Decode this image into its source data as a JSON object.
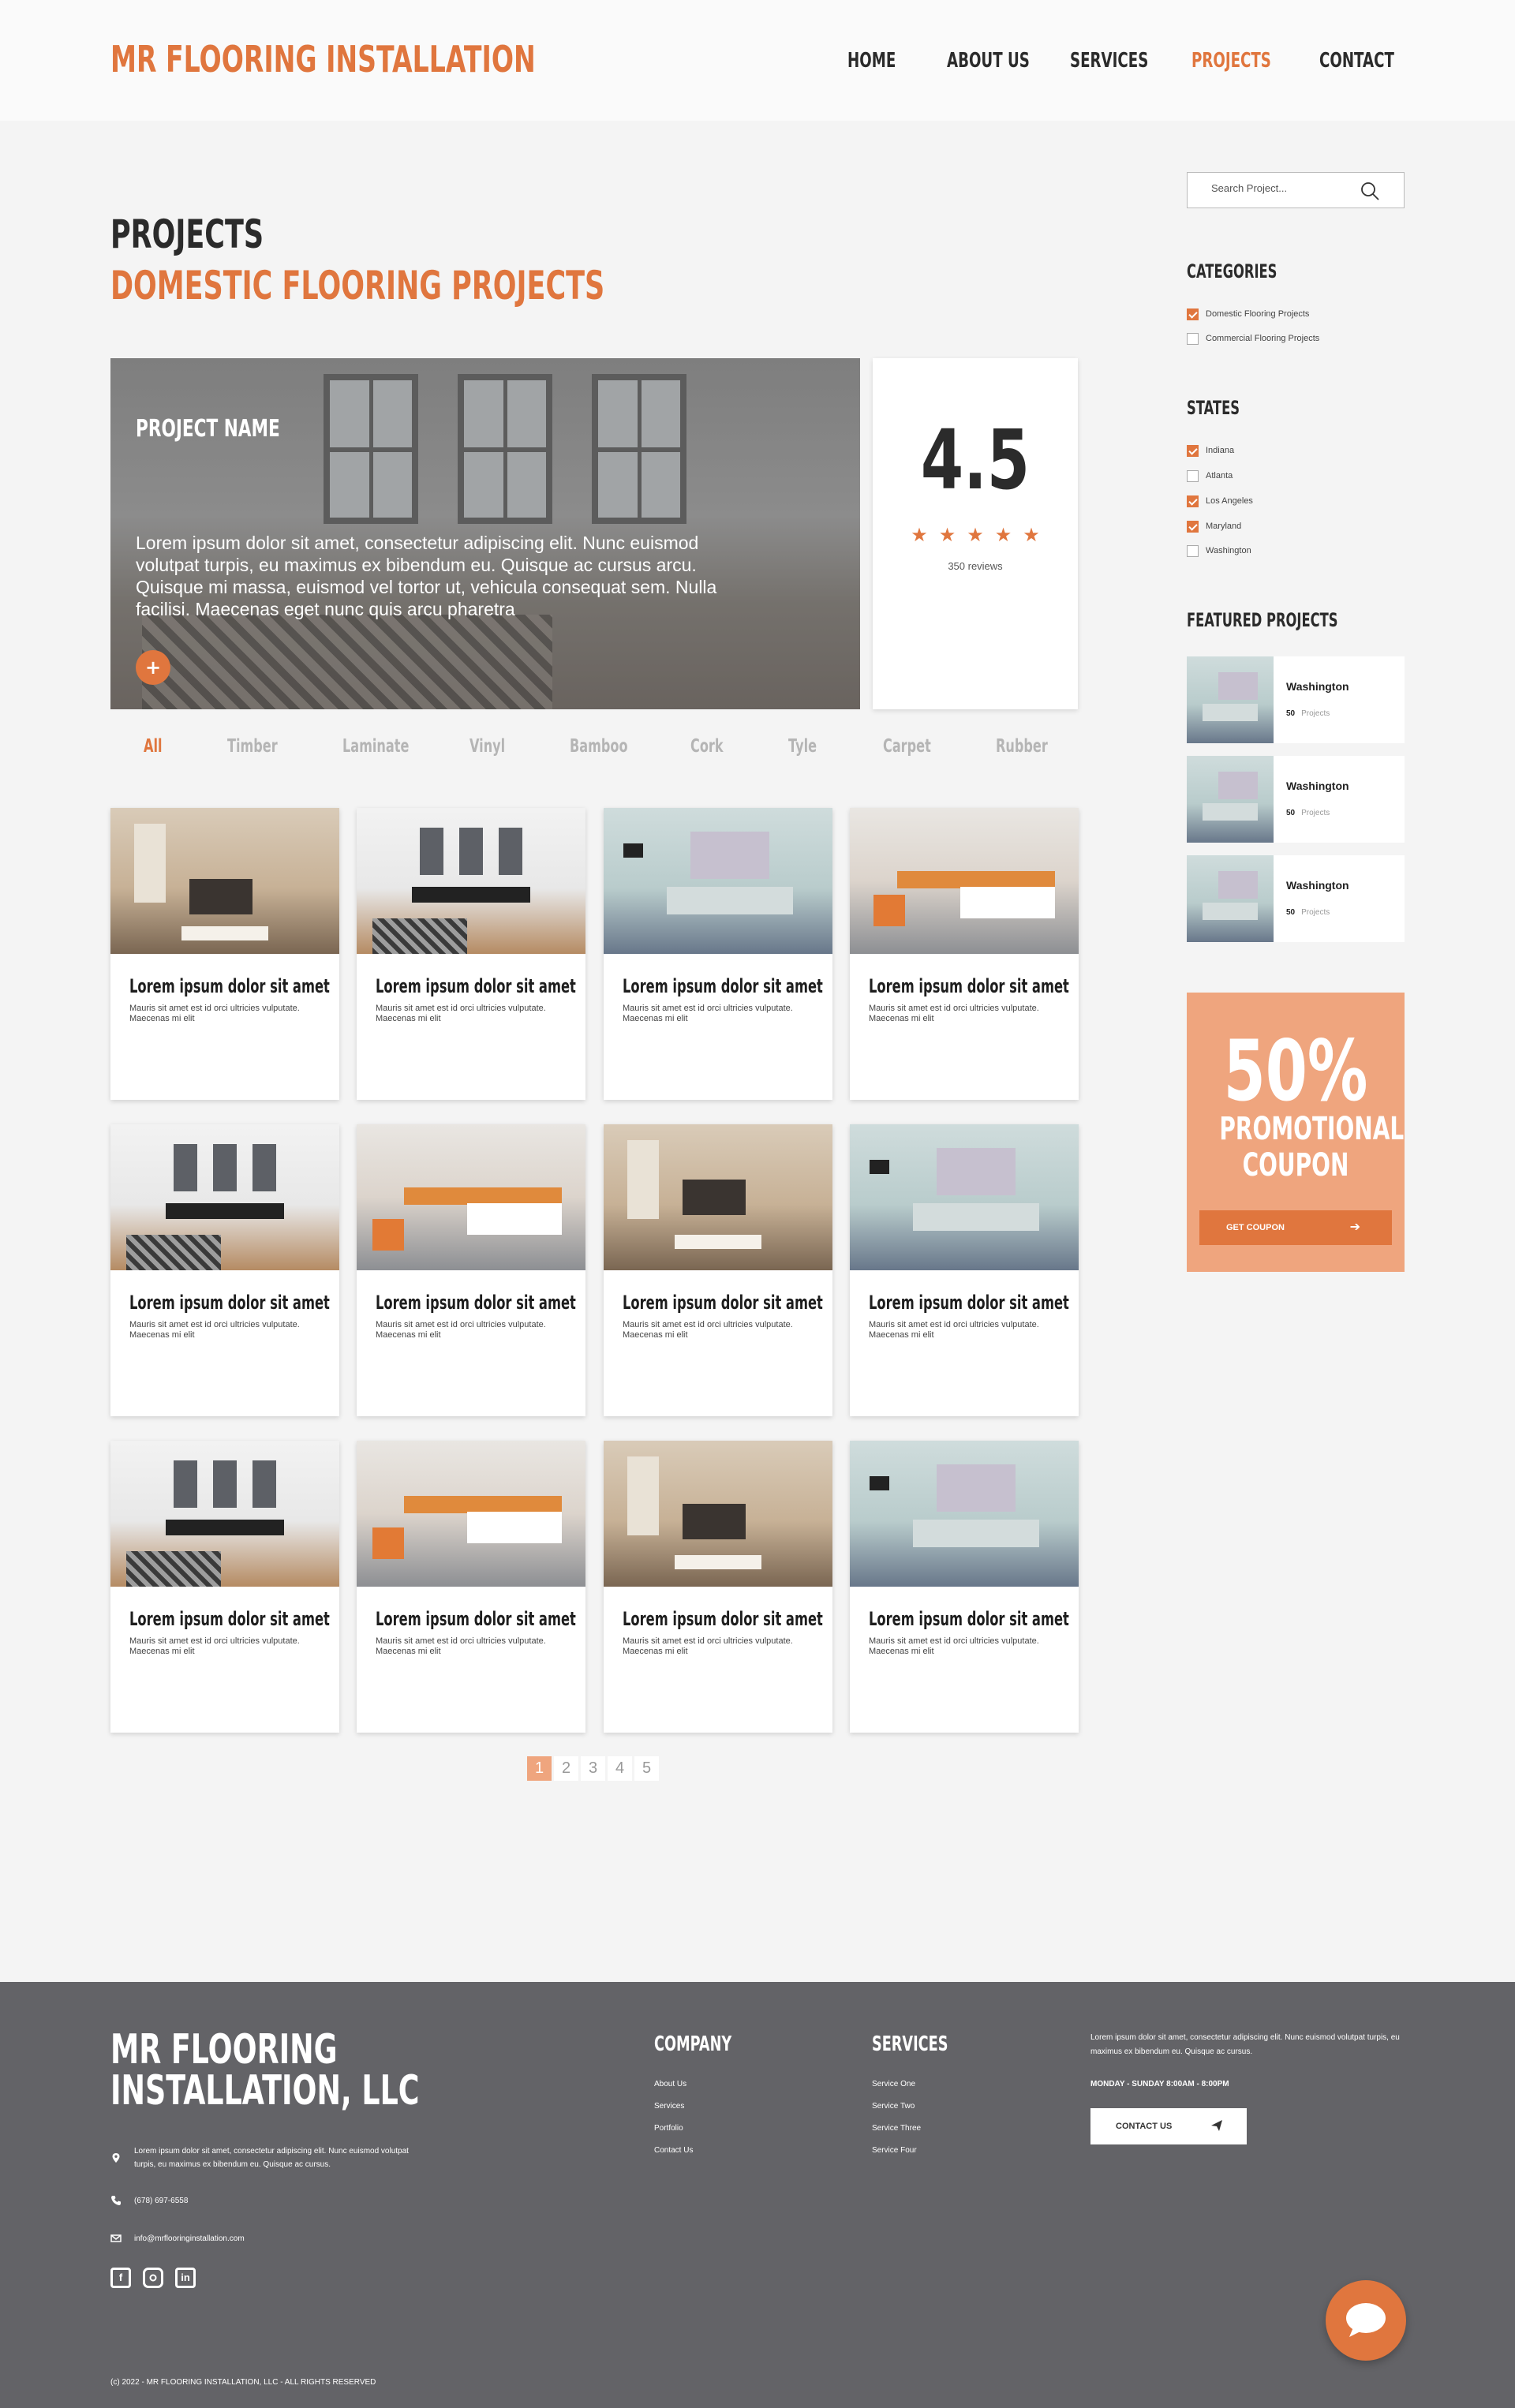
{
  "header": {
    "logo": "MR FLOORING INSTALLATION",
    "nav": [
      "HOME",
      "ABOUT US",
      "SERVICES",
      "PROJECTS",
      "CONTACT"
    ],
    "active_nav": "PROJECTS"
  },
  "page": {
    "title": "PROJECTS",
    "subtitle": "DOMESTIC FLOORING PROJECTS"
  },
  "hero": {
    "name": "PROJECT NAME",
    "text": "Lorem ipsum dolor sit amet, consectetur adipiscing elit. Nunc euismod volutpat turpis, eu maximus ex bibendum eu. Quisque ac cursus arcu. Quisque mi massa, euismod vel tortor ut, vehicula consequat sem. Nulla facilisi. Maecenas eget nunc quis arcu pharetra",
    "plus": "+"
  },
  "rating": {
    "value": "4.5",
    "stars": 5,
    "reviews": "350 reviews"
  },
  "filters": [
    "All",
    "Timber",
    "Laminate",
    "Vinyl",
    "Bamboo",
    "Cork",
    "Tyle",
    "Carpet",
    "Rubber"
  ],
  "cards": [
    {
      "title": "Lorem ipsum dolor sit amet",
      "desc": "Mauris sit amet est id orci ultricies vulputate. Maecenas mi elit"
    },
    {
      "title": "Lorem ipsum dolor sit amet",
      "desc": "Mauris sit amet est id orci ultricies vulputate. Maecenas mi elit"
    },
    {
      "title": "Lorem ipsum dolor sit amet",
      "desc": "Mauris sit amet est id orci ultricies vulputate. Maecenas mi elit"
    },
    {
      "title": "Lorem ipsum dolor sit amet",
      "desc": "Mauris sit amet est id orci ultricies vulputate. Maecenas mi elit"
    },
    {
      "title": "Lorem ipsum dolor sit amet",
      "desc": "Mauris sit amet est id orci ultricies vulputate. Maecenas mi elit"
    },
    {
      "title": "Lorem ipsum dolor sit amet",
      "desc": "Mauris sit amet est id orci ultricies vulputate. Maecenas mi elit"
    },
    {
      "title": "Lorem ipsum dolor sit amet",
      "desc": "Mauris sit amet est id orci ultricies vulputate. Maecenas mi elit"
    },
    {
      "title": "Lorem ipsum dolor sit amet",
      "desc": "Mauris sit amet est id orci ultricies vulputate. Maecenas mi elit"
    },
    {
      "title": "Lorem ipsum dolor sit amet",
      "desc": "Mauris sit amet est id orci ultricies vulputate. Maecenas mi elit"
    },
    {
      "title": "Lorem ipsum dolor sit amet",
      "desc": "Mauris sit amet est id orci ultricies vulputate. Maecenas mi elit"
    },
    {
      "title": "Lorem ipsum dolor sit amet",
      "desc": "Mauris sit amet est id orci ultricies vulputate. Maecenas mi elit"
    },
    {
      "title": "Lorem ipsum dolor sit amet",
      "desc": "Mauris sit amet est id orci ultricies vulputate. Maecenas mi elit"
    }
  ],
  "pagination": {
    "pages": [
      "1",
      "2",
      "3",
      "4",
      "5"
    ],
    "current": "1"
  },
  "sidebar": {
    "search_placeholder": "Search Project...",
    "categories_heading": "CATEGORIES",
    "categories": [
      {
        "label": "Domestic Flooring Projects",
        "checked": true
      },
      {
        "label": "Commercial Flooring Projects",
        "checked": false
      }
    ],
    "states_heading": "STATES",
    "states": [
      {
        "label": "Indiana",
        "checked": true
      },
      {
        "label": "Atlanta",
        "checked": false
      },
      {
        "label": "Los Angeles",
        "checked": true
      },
      {
        "label": "Maryland",
        "checked": true
      },
      {
        "label": "Washington",
        "checked": false
      }
    ],
    "featured_heading": "FEATURED PROJECTS",
    "featured": [
      {
        "title": "Washington",
        "count": "50",
        "unit": "Projects"
      },
      {
        "title": "Washington",
        "count": "50",
        "unit": "Projects"
      },
      {
        "title": "Washington",
        "count": "50",
        "unit": "Projects"
      }
    ]
  },
  "promo": {
    "big": "50%",
    "line1": "PROMOTIONAL",
    "line2": "COUPON",
    "button": "GET COUPON"
  },
  "footer": {
    "logo_line1": "MR FLOORING",
    "logo_line2": "INSTALLATION, LLC",
    "address": "Lorem ipsum dolor sit amet, consectetur adipiscing elit. Nunc euismod volutpat turpis, eu maximus ex bibendum eu. Quisque ac cursus.",
    "phone": "(678) 697-6558",
    "email": "info@mrflooringinstallation.com",
    "company_heading": "COMPANY",
    "company_links": [
      "About Us",
      "Services",
      "Portfolio",
      "Contact Us"
    ],
    "services_heading": "SERVICES",
    "services_links": [
      "Service One",
      "Service Two",
      "Service Three",
      "Service Four"
    ],
    "about_text": "Lorem ipsum dolor sit amet, consectetur adipiscing elit. Nunc euismod volutpat turpis, eu maximus ex bibendum eu. Quisque ac cursus.",
    "hours": "MONDAY - SUNDAY 8:00AM - 8:00PM",
    "contact_button": "CONTACT US",
    "copyright": "(c) 2022 - MR FLOORING INSTALLATION, LLC - ALL RIGHTS RESERVED"
  },
  "colors": {
    "accent": "#e0763e",
    "promo_bg": "#efa57e",
    "footer_bg": "#636367"
  }
}
